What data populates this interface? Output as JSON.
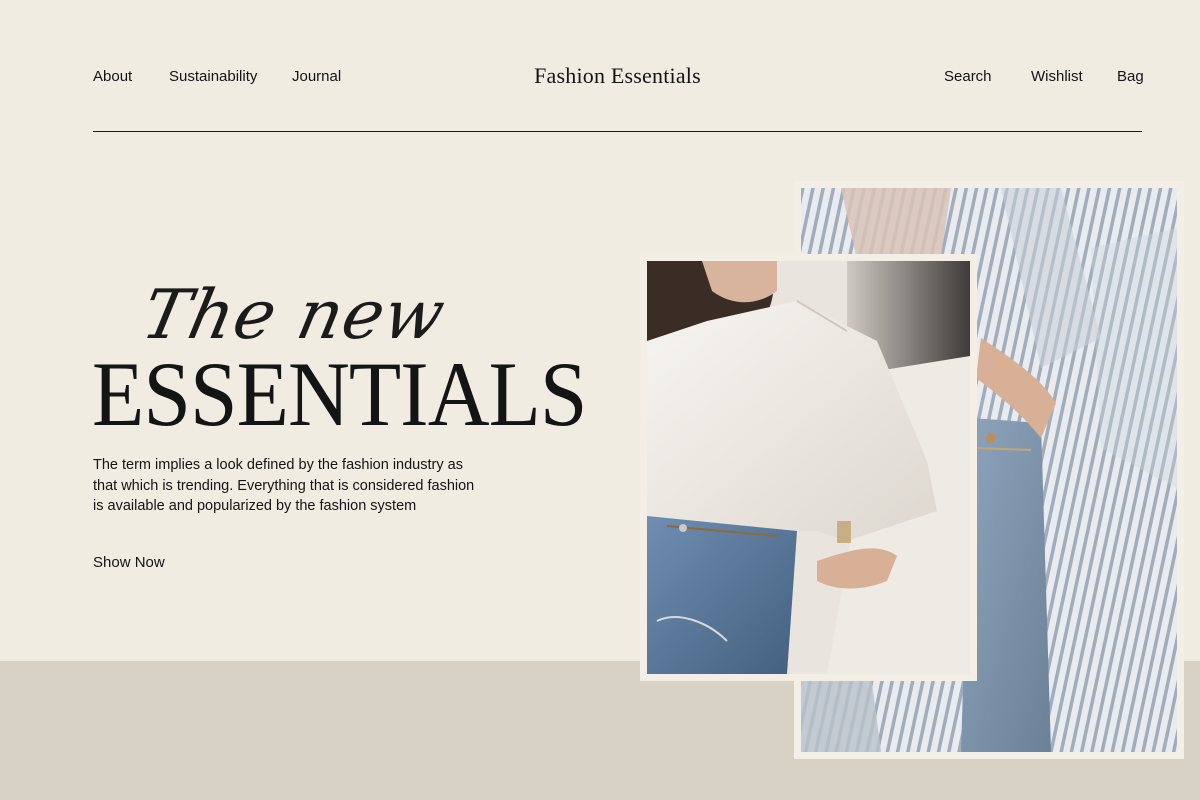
{
  "nav": {
    "left": [
      "About",
      "Sustainability",
      "Journal"
    ],
    "right": [
      "Search",
      "Wishlist",
      "Bag"
    ]
  },
  "brand": {
    "logo": "Fashion Essentials"
  },
  "hero": {
    "script_title": "The new",
    "title": "ESSENTIALS",
    "description": "The term implies a look defined by the fashion industry as that which is trending. Everything that is considered fashion is available and popularized by the fashion system",
    "cta_label": "Show Now"
  },
  "colors": {
    "background": "#f1ece2",
    "band": "#d8d2c5",
    "text": "#141414"
  }
}
